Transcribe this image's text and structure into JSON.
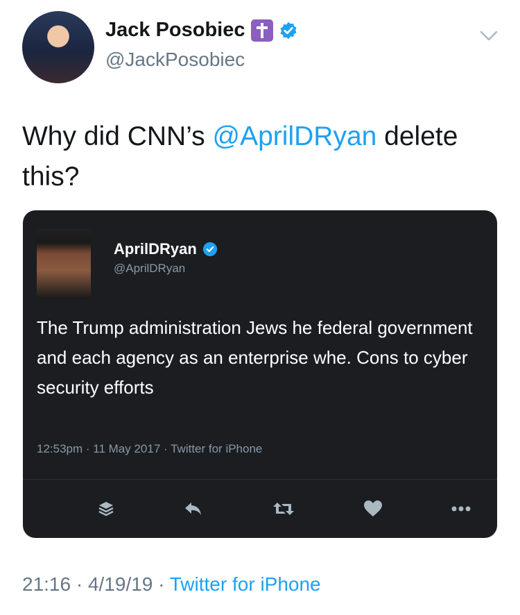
{
  "author": {
    "display_name": "Jack Posobiec",
    "handle": "@JackPosobiec",
    "badge_icon": "latin-cross-icon",
    "verified_icon": "verified-badge-icon"
  },
  "tweet": {
    "text_prefix": "Why did CNN’s ",
    "mention": "@AprilDRyan",
    "text_suffix": " delete this?"
  },
  "embedded_tweet": {
    "display_name": "AprilDRyan",
    "handle": "@AprilDRyan",
    "body": "The Trump administration Jews he federal government and each agency as an enterprise whe. Cons to cyber security efforts",
    "meta": "12:53pm · 11 May 2017 · Twitter for iPhone",
    "actions": [
      "layers-icon",
      "reply-icon",
      "retweet-icon",
      "heart-icon",
      "more-icon"
    ]
  },
  "footer": {
    "timestamp": "21:16 · 4/19/19 · ",
    "source": "Twitter for iPhone"
  },
  "colors": {
    "link": "#1da1f2",
    "secondary_text": "#657786",
    "embed_bg": "#1b1d21",
    "badge_purple": "#8b5fbf"
  }
}
